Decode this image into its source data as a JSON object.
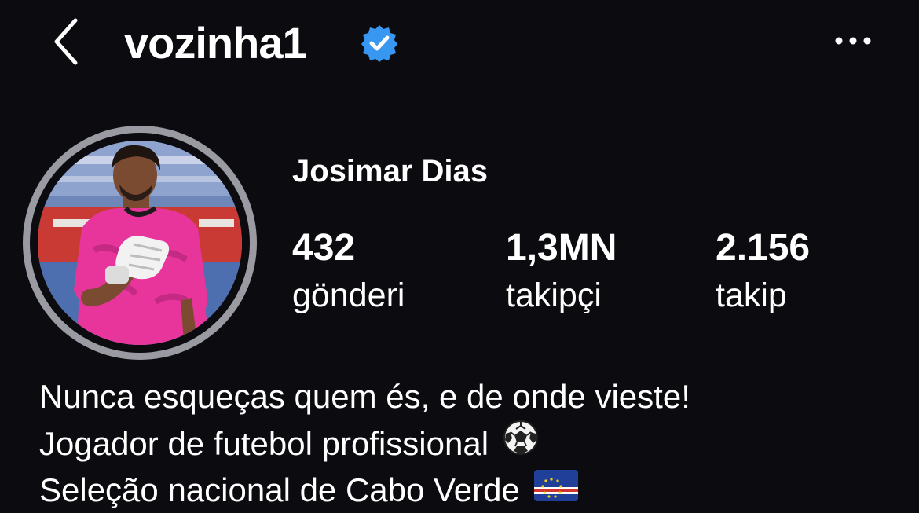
{
  "header": {
    "username": "vozinha1",
    "back_icon": "chevron-left-icon",
    "verified_icon": "verified-badge-icon",
    "more_icon": "more-horizontal-icon"
  },
  "profile": {
    "full_name": "Josimar Dias",
    "avatar_icon": "profile-photo",
    "stats": [
      {
        "value": "432",
        "label": "gönderi"
      },
      {
        "value": "1,3MN",
        "label": "takipçi"
      },
      {
        "value": "2.156",
        "label": "takip"
      }
    ]
  },
  "bio": {
    "lines": [
      {
        "text": "Nunca esqueças quem és, e de onde vieste!"
      },
      {
        "text": "Jogador de futebol profissional",
        "icon": "soccer-ball-icon"
      },
      {
        "text": "Seleção nacional de Cabo Verde",
        "icon": "cape-verde-flag-icon"
      }
    ]
  },
  "colors": {
    "background": "#0c0c10",
    "text": "#ffffff",
    "verified_blue": "#3897f0",
    "avatar_ring": "#9a9aa2",
    "jersey_pink": "#e8359b"
  }
}
